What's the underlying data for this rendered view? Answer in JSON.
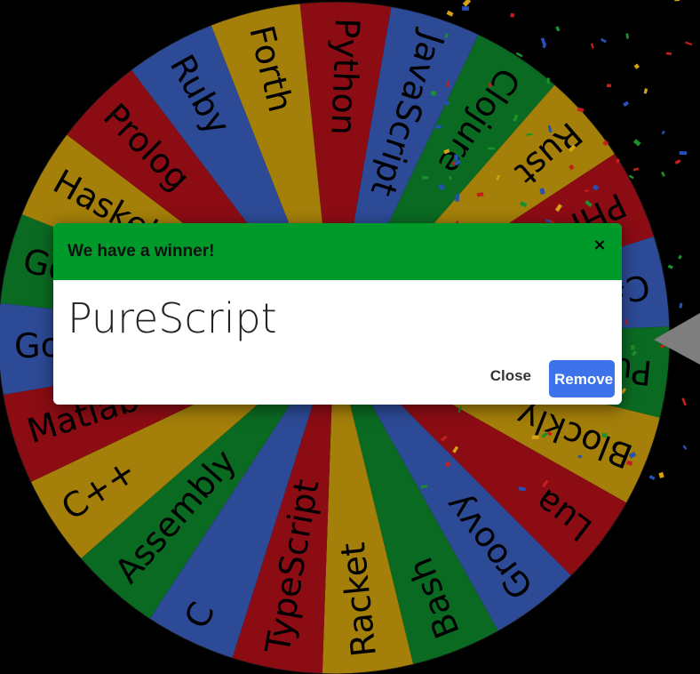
{
  "wheel": {
    "colors": {
      "red": "#8c0c14",
      "blue": "#2d4a96",
      "gold": "#a47f0a",
      "green": "#0b6a22"
    },
    "pointer_color": "#7e7e7e",
    "segments": [
      {
        "label": "Python",
        "color": "red"
      },
      {
        "label": "JavaScript",
        "color": "blue"
      },
      {
        "label": "Clojure",
        "color": "green"
      },
      {
        "label": "Rust",
        "color": "gold"
      },
      {
        "label": "PHP",
        "color": "red"
      },
      {
        "label": "C#",
        "color": "blue"
      },
      {
        "label": "PureScript",
        "color": "green"
      },
      {
        "label": "Blockly",
        "color": "gold"
      },
      {
        "label": "Lua",
        "color": "red"
      },
      {
        "label": "Groovy",
        "color": "blue"
      },
      {
        "label": "Bash",
        "color": "green"
      },
      {
        "label": "Racket",
        "color": "gold"
      },
      {
        "label": "TypeScript",
        "color": "red"
      },
      {
        "label": "C",
        "color": "blue"
      },
      {
        "label": "Assembly",
        "color": "green"
      },
      {
        "label": "C++",
        "color": "gold"
      },
      {
        "label": "Matlab",
        "color": "red"
      },
      {
        "label": "Golang",
        "color": "blue"
      },
      {
        "label": "Go",
        "color": "green"
      },
      {
        "label": "Haskell",
        "color": "gold"
      },
      {
        "label": "Prolog",
        "color": "red"
      },
      {
        "label": "Ruby",
        "color": "blue"
      },
      {
        "label": "Forth",
        "color": "gold"
      }
    ]
  },
  "dialog": {
    "title": "We have a winner!",
    "close_icon": "close-icon",
    "close_glyph": "×",
    "winner": "PureScript",
    "close_label": "Close",
    "remove_label": "Remove",
    "header_color": "#009a2a",
    "remove_color": "#3d72ea"
  }
}
